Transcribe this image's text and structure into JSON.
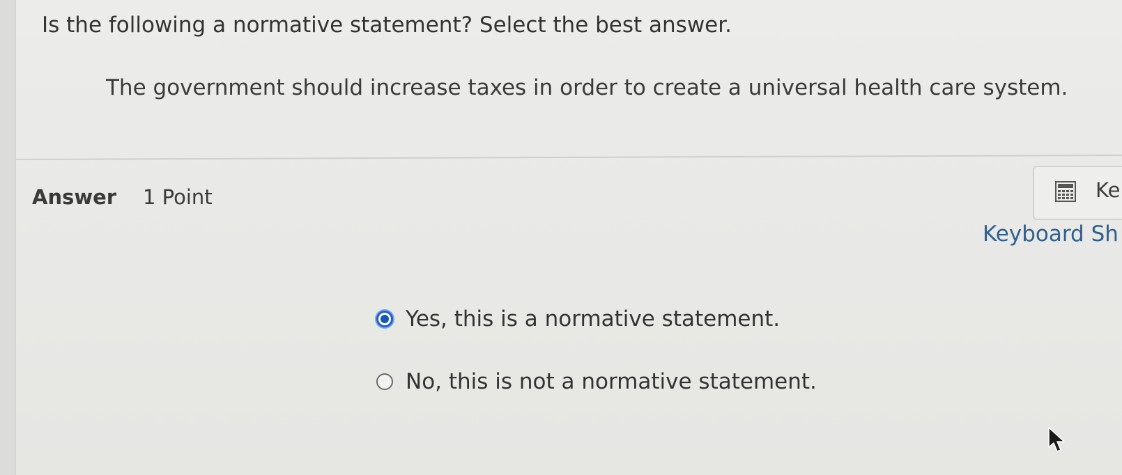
{
  "question": {
    "prompt": "Is the following a normative statement? Select the best answer.",
    "statement": "The government should increase taxes in order to create a universal health care system."
  },
  "answer": {
    "heading": "Answer",
    "points": "1 Point"
  },
  "tools": {
    "button_label": "Ke",
    "button_icon": "calculator-icon",
    "shortcuts_link": "Keyboard Sh"
  },
  "options": [
    {
      "label": "Yes, this is a normative statement.",
      "selected": true
    },
    {
      "label": "No, this is not a normative statement.",
      "selected": false
    }
  ],
  "colors": {
    "selected_radio": "#1a52bf",
    "link": "#2f5f8f"
  }
}
